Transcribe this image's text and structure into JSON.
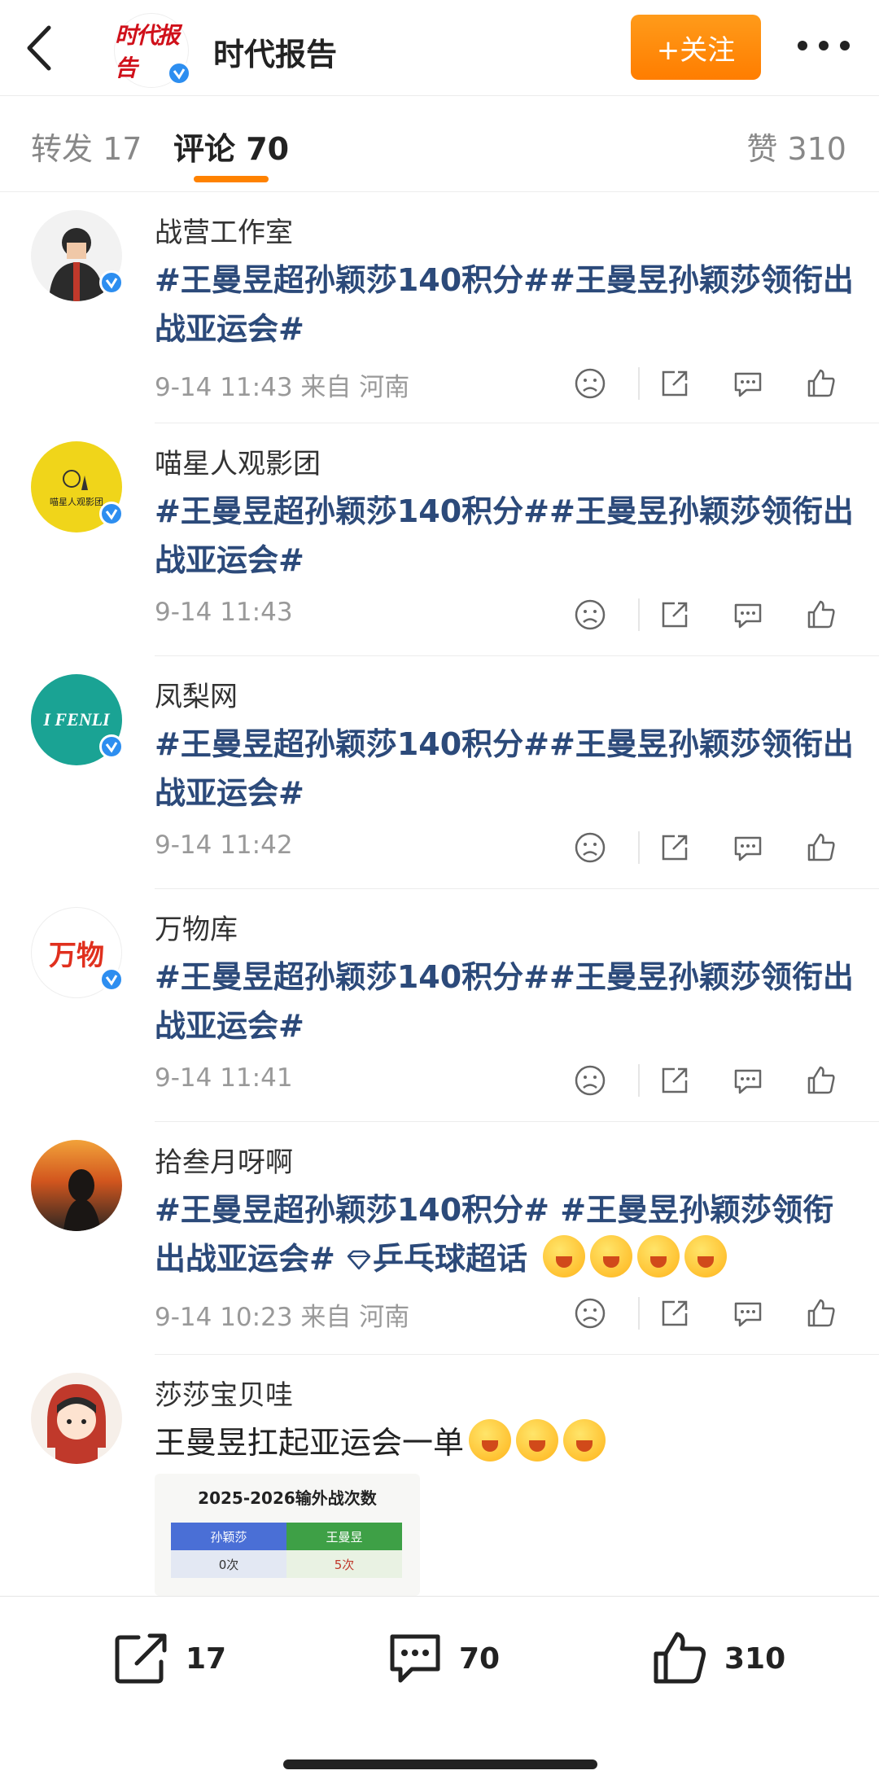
{
  "header": {
    "logo_text": "时代报告",
    "title": "时代报告",
    "follow_label": "+关注"
  },
  "tabs": {
    "repost": "转发 17",
    "comment": "评论 70",
    "like": "赞 310"
  },
  "comments": [
    {
      "name": "战营工作室",
      "text": "#王曼昱超孙颖莎140积分##王曼昱孙颖莎领衔出战亚运会#",
      "meta": "9-14 11:43  来自 河南"
    },
    {
      "name": "喵星人观影团",
      "avatar_text": "喵星人观影团",
      "text": "#王曼昱超孙颖莎140积分##王曼昱孙颖莎领衔出战亚运会#",
      "meta": "9-14 11:43"
    },
    {
      "name": "凤梨网",
      "avatar_text": "I FENLI",
      "text": "#王曼昱超孙颖莎140积分##王曼昱孙颖莎领衔出战亚运会#",
      "meta": "9-14 11:42"
    },
    {
      "name": "万物库",
      "avatar_text": "万物",
      "text": "#王曼昱超孙颖莎140积分##王曼昱孙颖莎领衔出战亚运会#",
      "meta": "9-14 11:41"
    },
    {
      "name": "拾叁月呀啊",
      "text_part1": "#王曼昱超孙颖莎140积分# #王曼昱孙颖莎领衔出战亚运会#",
      "text_part2": "乒乓球超话",
      "meta": "9-14 10:23  来自 河南"
    },
    {
      "name": "莎莎宝贝哇",
      "text": "王曼昱扛起亚运会一单",
      "meta": ""
    }
  ],
  "embedded_table": {
    "title": "2025-2026输外战次数",
    "headers": [
      "孙颖莎",
      "王曼昱"
    ],
    "values": [
      "0次",
      "5次"
    ]
  },
  "bottom_bar": {
    "repost_count": "17",
    "comment_count": "70",
    "like_count": "310"
  },
  "colors": {
    "accent": "#ff8200",
    "topic": "#2c4a7a",
    "verified": "#2d8ef0"
  }
}
